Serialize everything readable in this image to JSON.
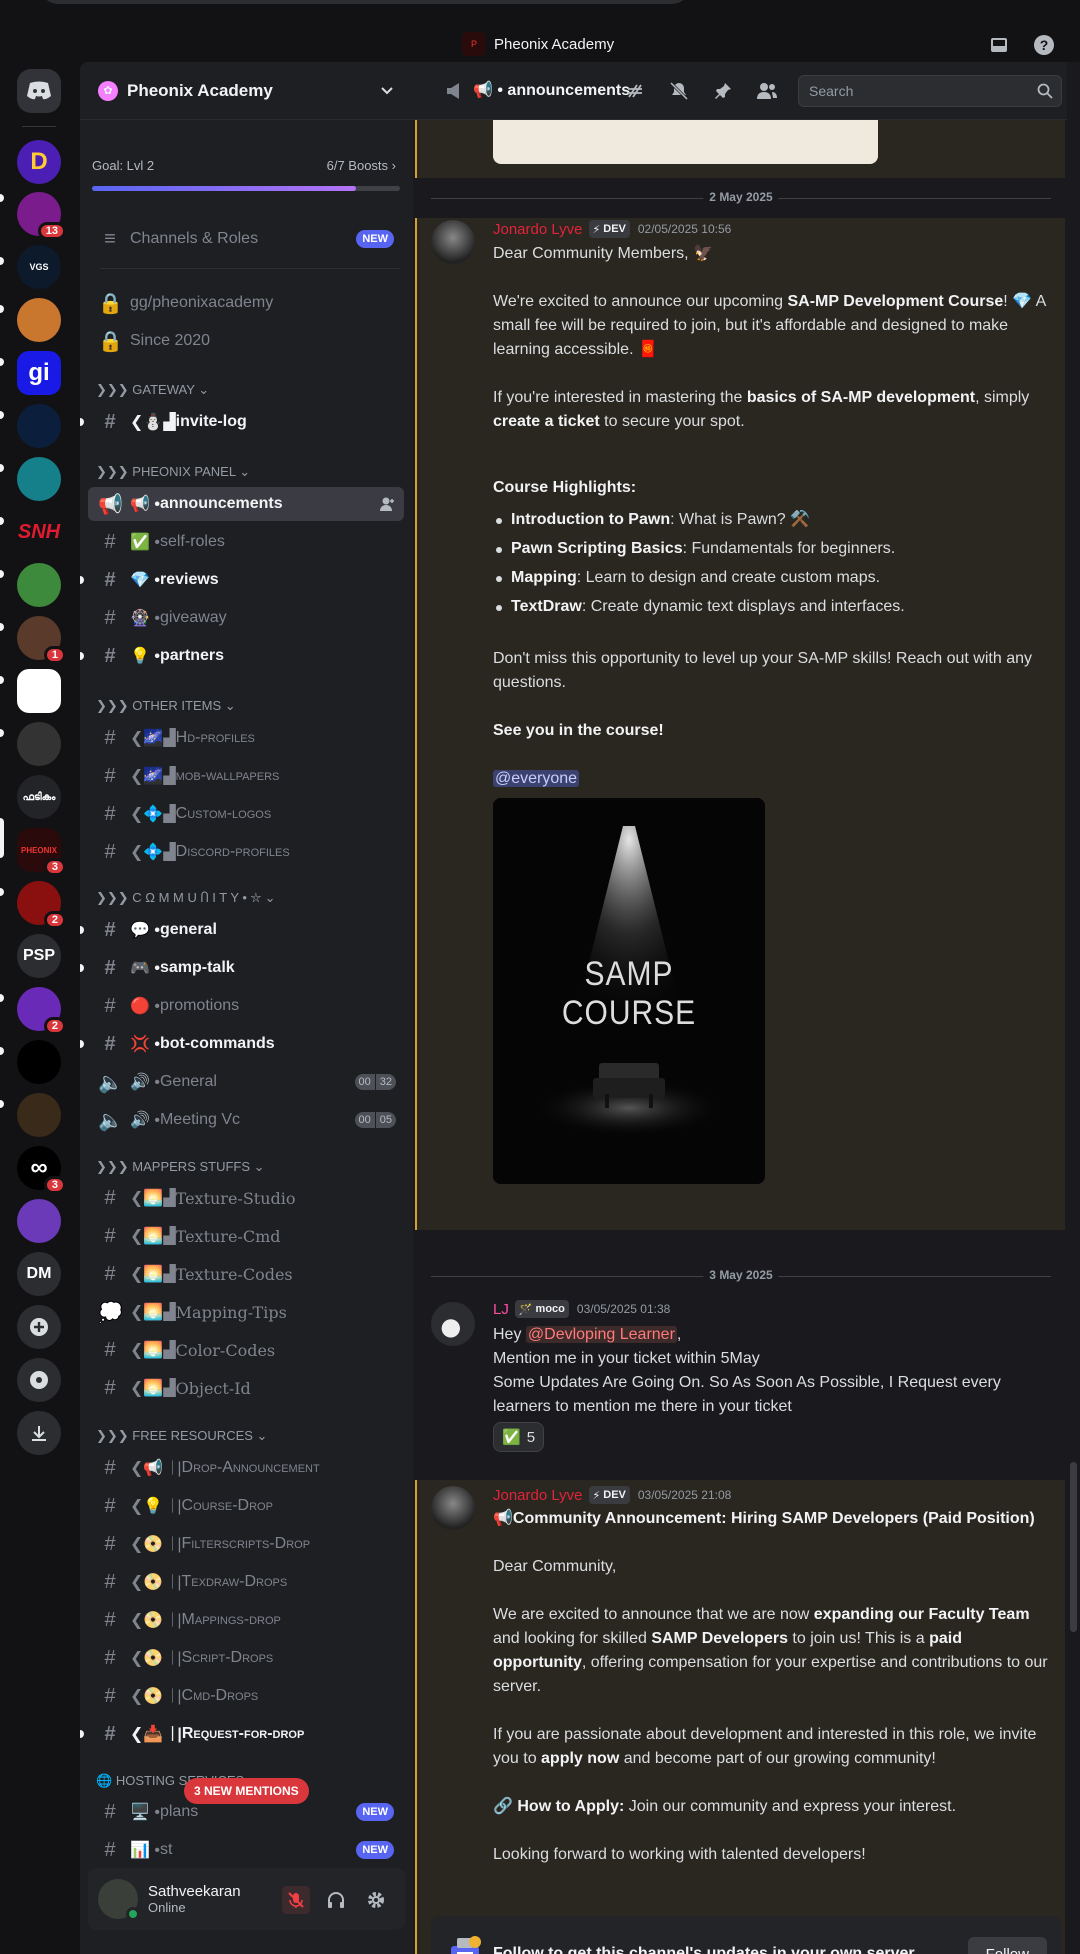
{
  "window": {
    "title": "Pheonix Academy"
  },
  "rail": {
    "dm_labels": [
      "PSP",
      "DM"
    ],
    "badges": [
      "13",
      "1",
      "3",
      "2",
      "2",
      "3"
    ]
  },
  "guild": {
    "name": "Pheonix Academy",
    "boost_goal": "Goal: Lvl 2",
    "boost_count": "6/7 Boosts",
    "boost_progress": 0.857
  },
  "sidebar": {
    "channels_roles": "Channels & Roles",
    "new": "NEW",
    "vanity": "gg/pheonixacademy",
    "since": "Since 2020",
    "cat_gateway": "❯❯❯ GATEWAY",
    "invite_log": "invite-log",
    "cat_panel": "❯❯❯ PHEONIX PANEL",
    "announcements": "announcements",
    "self_roles": "self-roles",
    "reviews": "reviews",
    "giveaway": "giveaway",
    "partners": "partners",
    "cat_other": "❯❯❯ OTHER ITEMS",
    "hd_profiles": "Hd-profiles",
    "mob_wallpapers": "mob-wallpapers",
    "custom_logos": "Custom-logos",
    "discord_profiles": "Discord-profiles",
    "cat_community": "❯❯❯ C Ω M M U Ⴖ I T Y",
    "general": "general",
    "samp_talk": "samp-talk",
    "promotions": "promotions",
    "bot_commands": "bot-commands",
    "vc_general": "General",
    "vc_general_a": "00",
    "vc_general_b": "32",
    "vc_meeting": "Meeting Vc",
    "vc_meeting_a": "00",
    "vc_meeting_b": "05",
    "cat_mappers": "❯❯❯ MAPPERS STUFFS",
    "texture_studio": "Texture-Studio",
    "texture_cmd": "Texture-Cmd",
    "texture_codes": "Texture-Codes",
    "mapping_tips": "Mapping-Tips",
    "color_codes": "Color-Codes",
    "object_id": "Object-Id",
    "cat_free": "❯❯❯ FREE RESOURCES",
    "drop_announcement": "Drop-Announcement",
    "course_drop": "Course-Drop",
    "filterscripts_drop": "Filterscripts-Drop",
    "texdraw_drops": "Texdraw-Drops",
    "mappings_drop": "Mappings-drop",
    "script_drops": "Script-Drops",
    "cmd_drops": "Cmd-Drops",
    "request_for_drop": "Request-for-drop",
    "cat_hosting": "HOSTING SERVICES",
    "plans": "plans",
    "stats": "st",
    "new_mentions": "3 NEW MENTIONS"
  },
  "user": {
    "name": "Sathveekaran",
    "status": "Online"
  },
  "channel": {
    "name": "📢 • announcements",
    "search_placeholder": "Search"
  },
  "messages": {
    "day1": "2 May 2025",
    "m1_author": "Jonardo Lyve",
    "m1_tag": "DEV",
    "m1_time": "02/05/2025 10:56",
    "m1_l1": "Dear Community Members, 🦅",
    "m1_l2a": "We're excited to announce our upcoming ",
    "m1_l2b": "SA-MP Development Course",
    "m1_l2c": "! 💎  A small fee will be required to join, but it's affordable and designed to make learning accessible. 🧧",
    "m1_l3a": "If you're interested in mastering the ",
    "m1_l3b": "basics of SA-MP development",
    "m1_l3c": ", simply ",
    "m1_l3d": "create a ticket",
    "m1_l3e": " to secure your spot.",
    "m1_hl": "Course Highlights:",
    "m1_b1a": "Introduction to Pawn",
    "m1_b1b": ": What is Pawn? ⚒️",
    "m1_b2a": "Pawn Scripting Basics",
    "m1_b2b": ": Fundamentals for beginners.",
    "m1_b3a": "Mapping",
    "m1_b3b": ": Learn to design and create custom maps.",
    "m1_b4a": "TextDraw",
    "m1_b4b": ": Create dynamic text displays and interfaces.",
    "m1_l5": "Don't miss this opportunity to level up your SA-MP skills! Reach out with any questions.",
    "m1_l6": "See you in the course!",
    "m1_mention": "@everyone",
    "m1_img_l1": "SAMP",
    "m1_img_l2": "COURSE",
    "day2": "3 May 2025",
    "m2_author": "LJ",
    "m2_tag": "moco",
    "m2_time": "03/05/2025 01:38",
    "m2_l1a": "Hey ",
    "m2_l1b": "@Devloping Learner",
    "m2_l1c": ",",
    "m2_l2": "Mention me in your ticket within 5May",
    "m2_l3": "Some Updates Are Going On. So As Soon As Possible, I Request every learners to mention me there in your ticket",
    "m2_react_count": "5",
    "m3_author": "Jonardo Lyve",
    "m3_tag": "DEV",
    "m3_time": "03/05/2025 21:08",
    "m3_l1": "📢Community Announcement: Hiring SAMP Developers (Paid Position)",
    "m3_l2": "Dear Community,",
    "m3_l3a": "We are excited to announce that we are now ",
    "m3_l3b": "expanding our Faculty Team",
    "m3_l3c": " and looking for skilled ",
    "m3_l3d": "SAMP Developers",
    "m3_l3e": " to join us! This is a ",
    "m3_l3f": "paid opportunity",
    "m3_l3g": ", offering compensation for your expertise and contributions to our server.",
    "m3_l4a": "If you are passionate about development and interested in this role, we invite you to ",
    "m3_l4b": "apply now",
    "m3_l4c": " and become part of our growing community!",
    "m3_l5a": "🔗 How to Apply:",
    "m3_l5b": " Join our community and express your interest.",
    "m3_l6": "Looking forward to working with talented developers!"
  },
  "follow": {
    "text": "Follow to get this channel's updates in your own server.",
    "button": "Follow"
  },
  "colors": {
    "accent": "#5865f2",
    "announce_author": "#e0243b",
    "mention_bg": "#da373c",
    "highlight_border": "#d3a12c"
  }
}
